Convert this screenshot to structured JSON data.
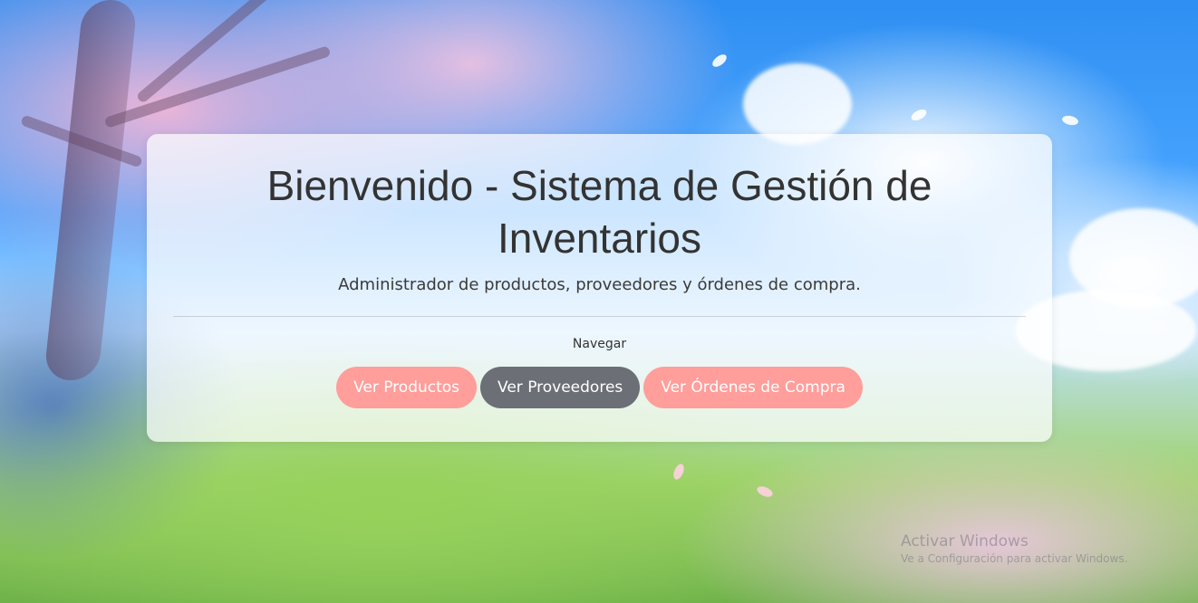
{
  "header": {
    "title": "Bienvenido - Sistema de Gestión de Inventarios",
    "subtitle": "Administrador de productos, proveedores y órdenes de compra."
  },
  "nav": {
    "label": "Navegar",
    "buttons": [
      {
        "label": "Ver Productos",
        "color": "#ff9e9a"
      },
      {
        "label": "Ver Proveedores",
        "color": "#6c6f76"
      },
      {
        "label": "Ver Órdenes de Compra",
        "color": "#ff9e9a"
      }
    ]
  },
  "watermark": {
    "title": "Activar Windows",
    "subtitle": "Ve a Configuración para activar Windows."
  },
  "colors": {
    "accent_pink": "#ff9e9a",
    "secondary_gray": "#6c6f76",
    "text_dark": "#333333"
  }
}
